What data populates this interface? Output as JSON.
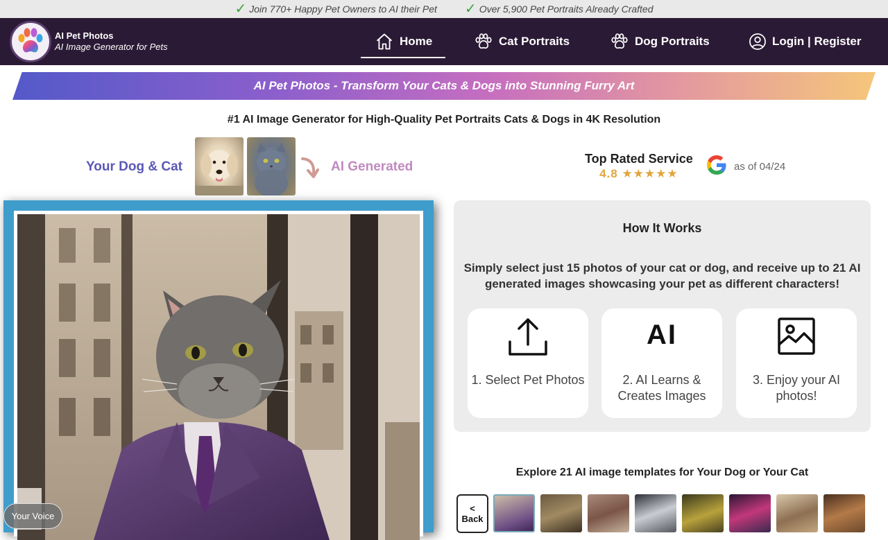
{
  "promo": {
    "items": [
      "Join 770+ Happy Pet Owners to AI their Pet",
      "Over 5,900 Pet Portraits Already Crafted"
    ]
  },
  "brand": {
    "name": "AI Pet Photos",
    "tagline": "AI Image Generator for Pets"
  },
  "nav": {
    "home": "Home",
    "cat": "Cat Portraits",
    "dog": "Dog Portraits",
    "login": "Login | Register"
  },
  "banner": "AI Pet Photos - Transform Your Cats & Dogs into Stunning Furry Art",
  "subtitle": "#1 AI Image Generator for High-Quality Pet Portraits Cats & Dogs in 4K Resolution",
  "compare": {
    "left_label": "Your Dog & Cat",
    "right_label": "AI Generated"
  },
  "rating": {
    "title": "Top Rated Service",
    "score": "4.8",
    "stars": "★★★★★",
    "as_of": "as of 04/24"
  },
  "voice_button": "Your Voice",
  "how": {
    "title": "How It Works",
    "description": "Simply select just 15 photos of your cat or dog, and receive up to 21 AI generated images showcasing your pet as different characters!",
    "steps": [
      {
        "icon": "upload-icon",
        "label": "1. Select Pet Photos"
      },
      {
        "icon": "ai-icon",
        "text": "AI",
        "label": "2. AI Learns & Creates Images"
      },
      {
        "icon": "image-icon",
        "label": "3. Enjoy your AI photos!"
      }
    ]
  },
  "explore": {
    "title": "Explore 21 AI image templates for Your Dog or Your Cat",
    "back_arrow": "<",
    "back_label": "Back"
  },
  "colors": {
    "nav_bg": "#2b1a35",
    "frame": "#3f9dcc",
    "accent_purple": "#5a58b6",
    "accent_pink": "#c08abf",
    "star": "#e2a53b"
  }
}
